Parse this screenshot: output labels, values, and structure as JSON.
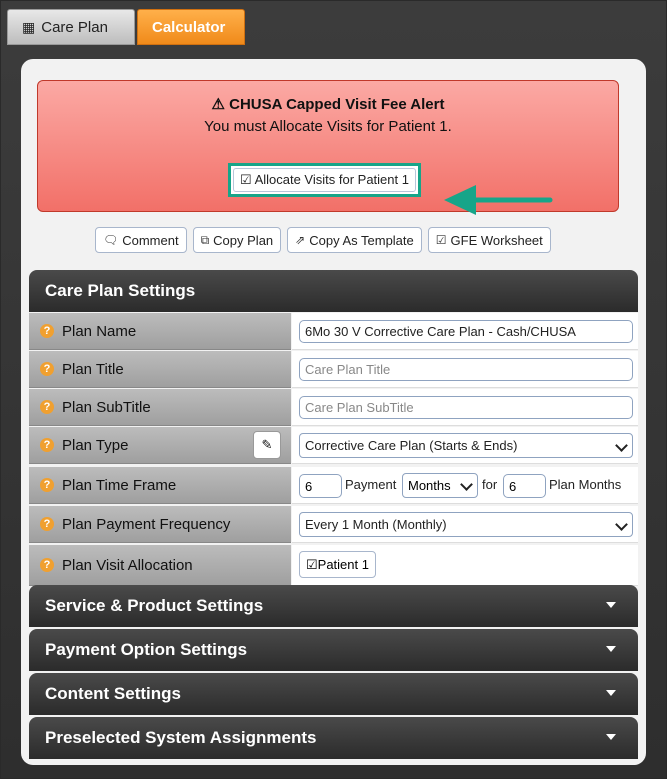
{
  "tabs": [
    {
      "label": "Care Plan",
      "icon": "calculator-icon"
    },
    {
      "label": "Calculator"
    }
  ],
  "alert": {
    "title": "CHUSA Capped Visit Fee Alert",
    "message": "You must Allocate Visits for Patient 1.",
    "button_label": "Allocate Visits for Patient 1",
    "icon": "warning-icon"
  },
  "actions": {
    "comment": "Comment",
    "copy_plan": "Copy Plan",
    "copy_as_template": "Copy As Template",
    "gfe_worksheet": "GFE Worksheet"
  },
  "care_plan_settings": {
    "header": "Care Plan Settings",
    "plan_name": {
      "label": "Plan Name",
      "value": "6Mo 30 V Corrective Care Plan - Cash/CHUSA"
    },
    "plan_title": {
      "label": "Plan Title",
      "placeholder": "Care Plan Title"
    },
    "plan_subtitle": {
      "label": "Plan SubTitle",
      "placeholder": "Care Plan SubTitle"
    },
    "plan_type": {
      "label": "Plan Type",
      "value": "Corrective Care Plan (Starts & Ends)"
    },
    "plan_time_frame": {
      "label": "Plan Time Frame",
      "count": "6",
      "payment_text": "Payment",
      "unit": "Months",
      "for_text": "for",
      "months": "6",
      "plan_months_text": "Plan Months"
    },
    "plan_payment_frequency": {
      "label": "Plan Payment Frequency",
      "value": "Every 1 Month (Monthly)"
    },
    "plan_visit_allocation": {
      "label": "Plan Visit Allocation",
      "patient_label": "Patient 1"
    }
  },
  "sections": [
    {
      "label": "Service & Product Settings"
    },
    {
      "label": "Payment Option Settings"
    },
    {
      "label": "Content Settings"
    },
    {
      "label": "Preselected System Assignments"
    }
  ],
  "colors": {
    "accent_orange": "#f08a1a",
    "alert_red": "#f27068",
    "highlight_teal": "#17a589"
  }
}
